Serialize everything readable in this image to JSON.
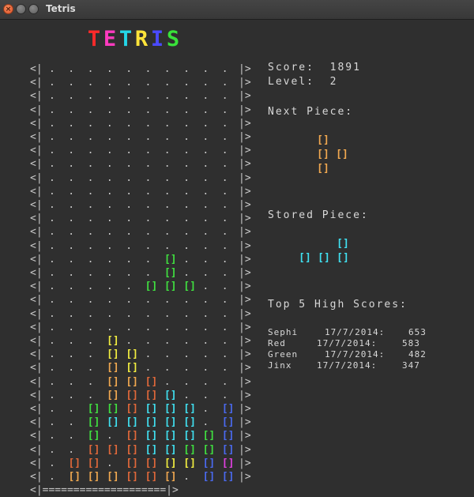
{
  "window": {
    "title": "Tetris"
  },
  "colors": {
    "T": "#ff2a2a",
    "E": "#ff3bbf",
    "T2": "#24d6e8",
    "R": "#ffe43a",
    "I": "#4a4aff",
    "S": "#39e23a",
    "text": "#d8d8d8",
    "yellow": "#f0ec40",
    "orange": "#f0a850",
    "red_orange": "#e0683a",
    "cyan": "#40e0f0",
    "green": "#40e040",
    "blue": "#4a6af0",
    "magenta": "#e040e0"
  },
  "title_letters": [
    {
      "ch": "T",
      "color": "#ff2a2a"
    },
    {
      "ch": "E",
      "color": "#ff3bbf"
    },
    {
      "ch": "T",
      "color": "#24d6e8"
    },
    {
      "ch": "R",
      "color": "#ffe43a"
    },
    {
      "ch": "I",
      "color": "#4a4aff"
    },
    {
      "ch": "S",
      "color": "#39e23a"
    }
  ],
  "board": {
    "cols": 10,
    "rows": 28,
    "empty_glyph": ".",
    "block_glyph": "[]",
    "left_edge": "<|",
    "right_edge": "|>",
    "floor": "<|====================|>",
    "palette": {
      "y": "#f0ec40",
      "o": "#f0a850",
      "r": "#e0683a",
      "c": "#40e0f0",
      "g": "#40e040",
      "b": "#4a6af0",
      "m": "#e040e0"
    },
    "grid": [
      "..........",
      "..........",
      "..........",
      "..........",
      "..........",
      "..........",
      "..........",
      "..........",
      "..........",
      "..........",
      "..........",
      "..........",
      "..........",
      "..........",
      "......g...",
      "......g...",
      ".....ggg..",
      "..........",
      "..........",
      "..........",
      "...y......",
      "...yy.....",
      "...oy.....",
      "...oor....",
      "...orrc...",
      "..ggrccc.b",
      "..gccccc.b",
      "..g.rcccgbb",
      "..rrrccggbb",
      ".rr.rryybmm",
      ".ooorro.bbbb"
    ]
  },
  "score": {
    "label": "Score:",
    "value": "1891"
  },
  "level": {
    "label": "Level:",
    "value": "2"
  },
  "next_piece": {
    "label": "Next Piece:",
    "color": "#f0a850"
  },
  "stored_piece": {
    "label": "Stored Piece:",
    "color": "#40e0f0"
  },
  "high_scores": {
    "label": "Top 5 High Scores:",
    "entries": [
      {
        "name": "Sephi",
        "date": "17/7/2014:",
        "score": "653"
      },
      {
        "name": "Red",
        "date": "17/7/2014:",
        "score": "583"
      },
      {
        "name": "Green",
        "date": "17/7/2014:",
        "score": "482"
      },
      {
        "name": "Jinx",
        "date": "17/7/2014:",
        "score": "347"
      }
    ]
  }
}
